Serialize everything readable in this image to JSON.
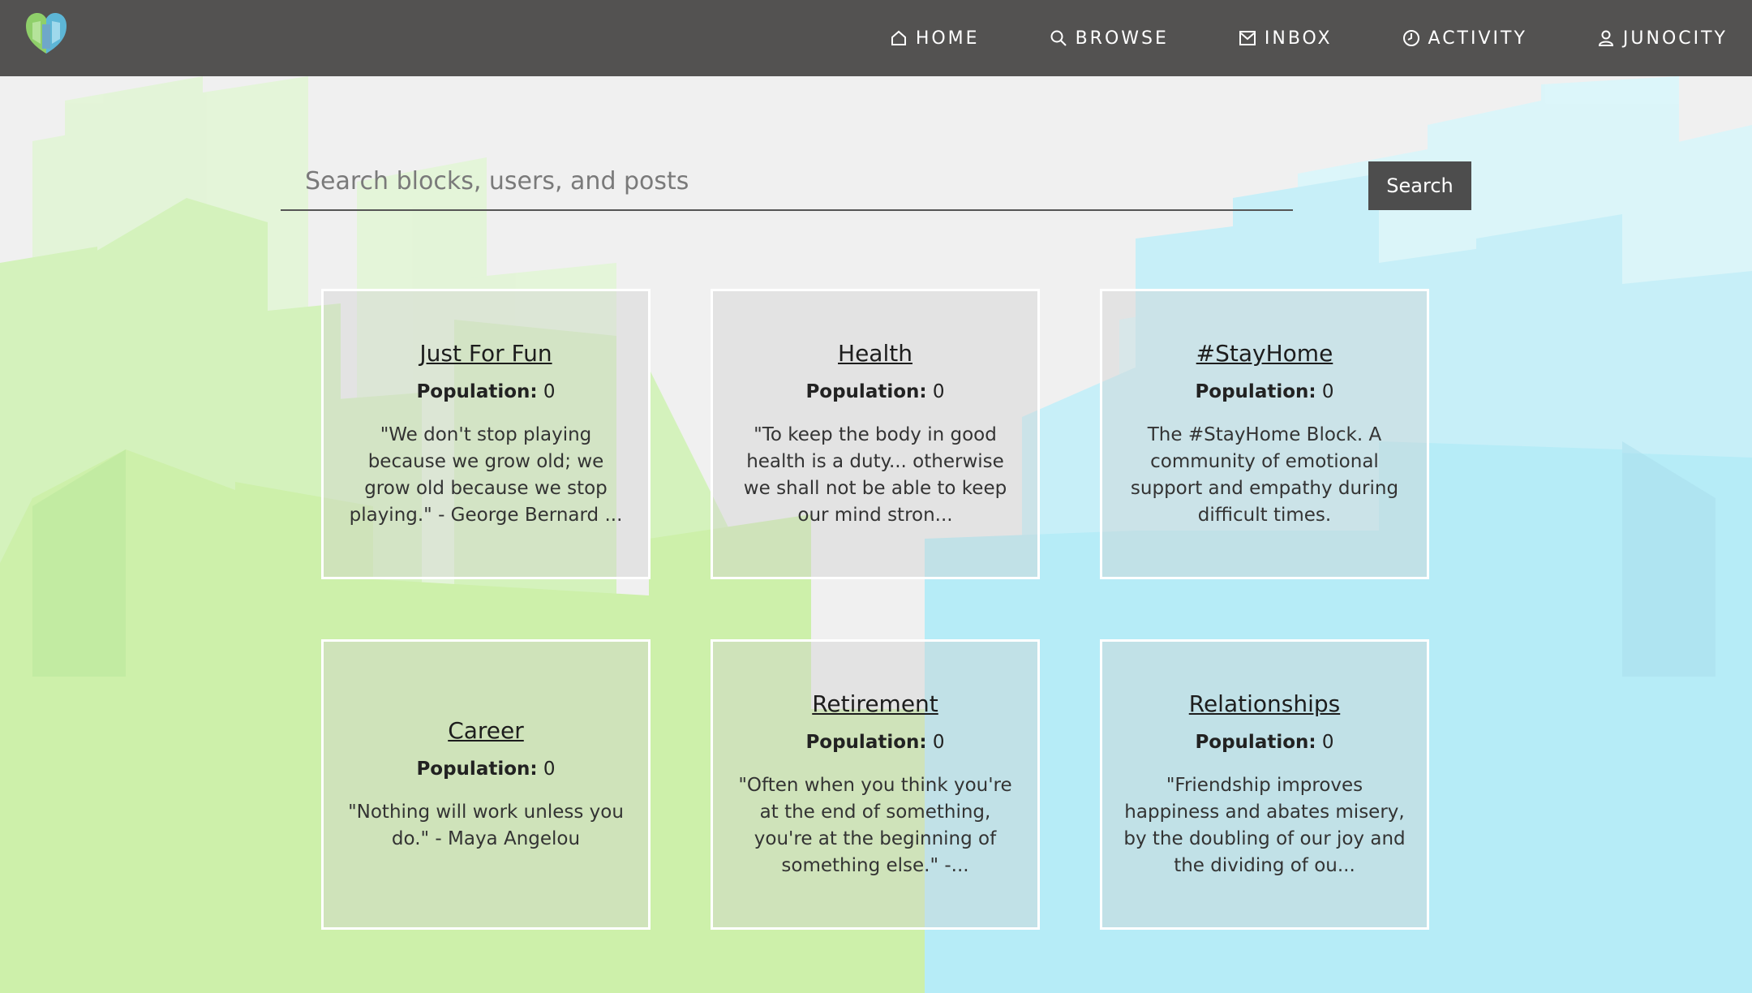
{
  "nav": {
    "items": [
      {
        "label": "HOME",
        "icon": "home-icon"
      },
      {
        "label": "BROWSE",
        "icon": "search-icon"
      },
      {
        "label": "INBOX",
        "icon": "inbox-icon"
      },
      {
        "label": "ACTIVITY",
        "icon": "clock-icon"
      },
      {
        "label": "JUNOCITY",
        "icon": "user-icon"
      }
    ]
  },
  "search": {
    "placeholder": "Search blocks, users, and posts",
    "value": "",
    "button_label": "Search"
  },
  "population_label": "Population:",
  "blocks": [
    {
      "title": "Just For Fun",
      "population": "0",
      "description": "\"We don't stop playing because we grow old; we grow old because we stop playing.\" - George Bernard ..."
    },
    {
      "title": "Health",
      "population": "0",
      "description": "\"To keep the body in good health is a duty... otherwise we shall not be able to keep our mind stron..."
    },
    {
      "title": "#StayHome",
      "population": "0",
      "description": "The #StayHome Block. A community of emotional support and empathy during difficult times."
    },
    {
      "title": "Career",
      "population": "0",
      "description": "\"Nothing will work unless you do.\" - Maya Angelou"
    },
    {
      "title": "Retirement",
      "population": "0",
      "description": "\"Often when you think you're at the end of something, you're at the beginning of something else.\" -..."
    },
    {
      "title": "Relationships",
      "population": "0",
      "description": "\"Friendship improves happiness and abates misery, by the doubling of our joy and the dividing of ou..."
    }
  ],
  "colors": {
    "topbar": "#535251",
    "background": "#f0f0f0",
    "city_green": "#cdf0aa",
    "city_blue": "#b6ecf7",
    "button": "#4d4d4d"
  }
}
